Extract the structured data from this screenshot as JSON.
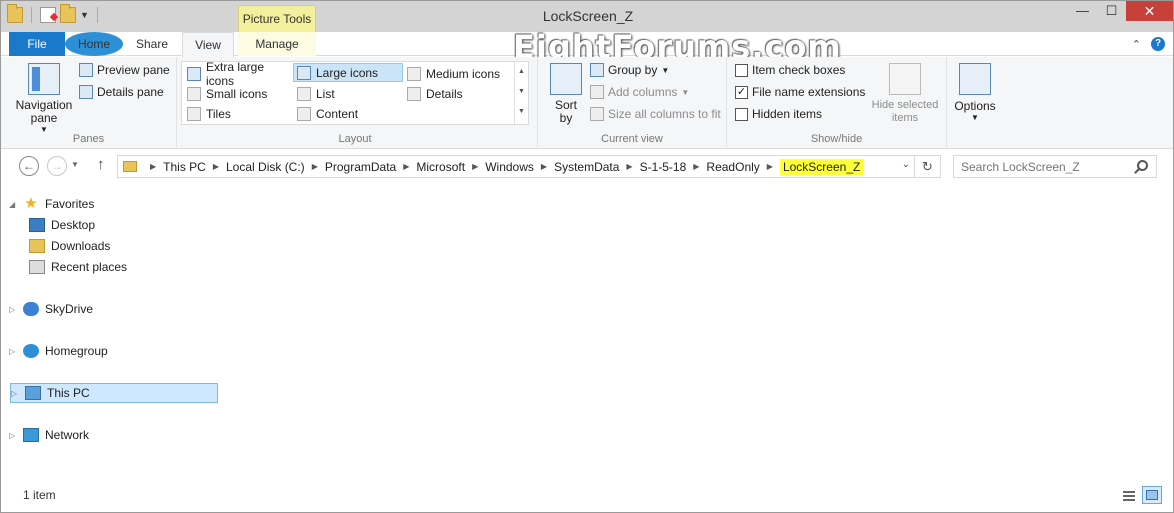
{
  "window": {
    "title": "LockScreen_Z",
    "context_tab_group": "Picture Tools",
    "controls": {
      "minimize": "—",
      "maximize": "☐",
      "close": "✕"
    }
  },
  "watermark": "EightForums.com",
  "tabs": {
    "file": "File",
    "home": "Home",
    "share": "Share",
    "view": "View",
    "manage": "Manage"
  },
  "ribbon": {
    "panes": {
      "label": "Panes",
      "navigation_pane": "Navigation pane",
      "preview_pane": "Preview pane",
      "details_pane": "Details pane"
    },
    "layout": {
      "label": "Layout",
      "items": [
        "Extra large icons",
        "Large icons",
        "Medium icons",
        "Small icons",
        "List",
        "Details",
        "Tiles",
        "Content"
      ],
      "selected": "Large icons"
    },
    "current_view": {
      "label": "Current view",
      "sort_by": "Sort by",
      "group_by": "Group by",
      "add_columns": "Add columns",
      "size_all_columns": "Size all columns to fit"
    },
    "show_hide": {
      "label": "Show/hide",
      "item_check_boxes": "Item check boxes",
      "item_check_boxes_checked": false,
      "file_name_extensions": "File name extensions",
      "file_name_extensions_checked": true,
      "hidden_items": "Hidden items",
      "hidden_items_checked": false,
      "hide_selected": "Hide selected items"
    },
    "options": "Options"
  },
  "address": {
    "crumbs": [
      "This PC",
      "Local Disk (C:)",
      "ProgramData",
      "Microsoft",
      "Windows",
      "SystemData",
      "S-1-5-18",
      "ReadOnly",
      "LockScreen_Z"
    ],
    "highlight_color": "#ffff3a"
  },
  "search": {
    "placeholder": "Search LockScreen_Z"
  },
  "navpane": {
    "favorites": "Favorites",
    "desktop": "Desktop",
    "downloads": "Downloads",
    "recent_places": "Recent places",
    "skydrive": "SkyDrive",
    "homegroup": "Homegroup",
    "this_pc": "This PC",
    "network": "Network"
  },
  "status": {
    "item_count": "1 item"
  },
  "colors": {
    "file_tab": "#1979ca",
    "context_tab": "#f4ef9c",
    "selection": "#cde8ff"
  }
}
